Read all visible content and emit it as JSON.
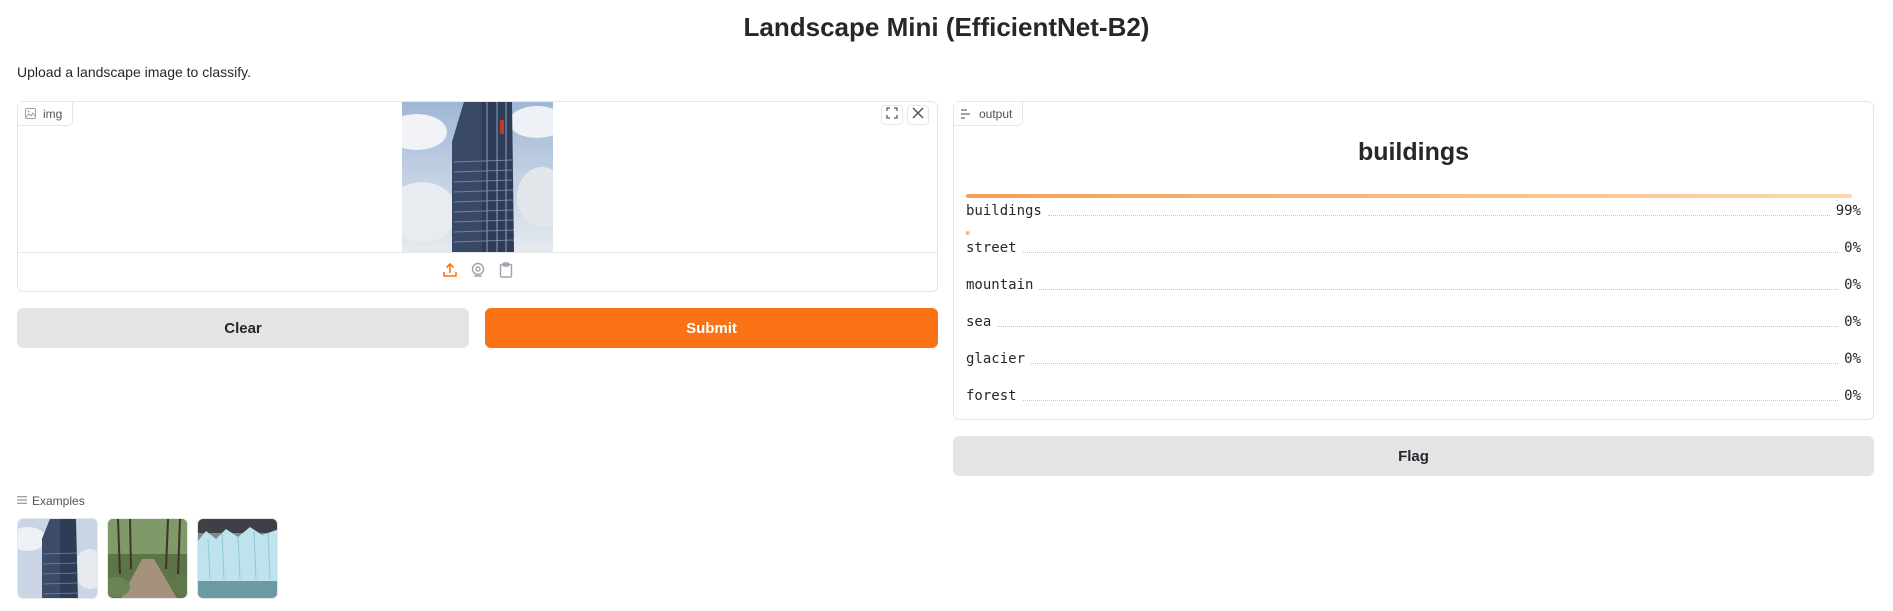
{
  "app": {
    "title": "Landscape Mini (EfficientNet-B2)",
    "description": "Upload a landscape image to classify."
  },
  "input": {
    "label": "img",
    "label_icon": "image-icon",
    "tools": [
      "fullscreen-icon",
      "close-icon"
    ],
    "sources": [
      "upload-icon",
      "webcam-icon",
      "clipboard-icon"
    ]
  },
  "actions": {
    "clear_label": "Clear",
    "submit_label": "Submit",
    "flag_label": "Flag"
  },
  "output": {
    "label": "output",
    "label_icon": "label-icon",
    "top_label": "buildings",
    "confidences": [
      {
        "label": "buildings",
        "value": "99%",
        "fraction": 0.99
      },
      {
        "label": "street",
        "value": "0%",
        "fraction": 0.004
      },
      {
        "label": "mountain",
        "value": "0%",
        "fraction": 0
      },
      {
        "label": "sea",
        "value": "0%",
        "fraction": 0
      },
      {
        "label": "glacier",
        "value": "0%",
        "fraction": 0
      },
      {
        "label": "forest",
        "value": "0%",
        "fraction": 0
      }
    ]
  },
  "examples": {
    "label": "Examples",
    "items": [
      "example-building",
      "example-forest-path",
      "example-glacier"
    ]
  },
  "colors": {
    "accent": "#f97316",
    "bar_start": "#f59e55",
    "bar_end": "#fcd9ae",
    "secondary_button": "#e4e4e7"
  }
}
